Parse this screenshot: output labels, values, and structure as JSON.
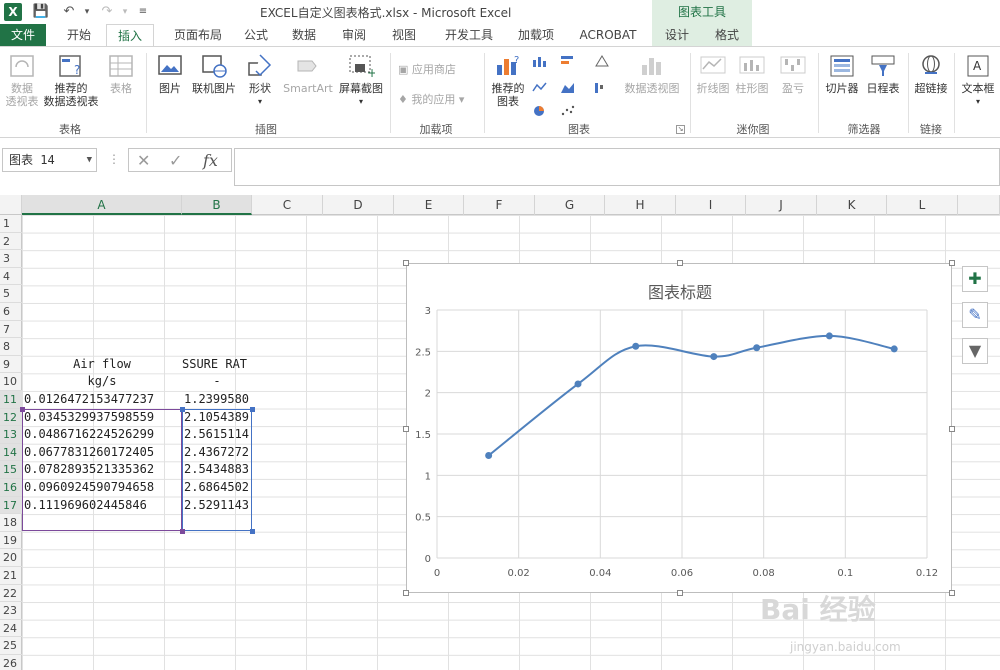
{
  "window": {
    "title": "EXCEL自定义图表格式.xlsx - Microsoft Excel",
    "app_icon": "X",
    "tools_tab_head": "图表工具"
  },
  "tabs": [
    "文件",
    "开始",
    "插入",
    "页面布局",
    "公式",
    "数据",
    "审阅",
    "视图",
    "开发工具",
    "加载项",
    "ACROBAT",
    "设计",
    "格式"
  ],
  "ribbon": {
    "groups": {
      "tables": "表格",
      "illustrations": "插图",
      "addins": "加载项",
      "charts": "图表",
      "sparklines": "迷你图",
      "filters": "筛选器",
      "links": "链接"
    },
    "buttons": {
      "pivot1": "数据",
      "pivot2": "透视表",
      "rec_pivot1": "推荐的",
      "rec_pivot2": "数据透视表",
      "table": "表格",
      "picture": "图片",
      "online_picture": "联机图片",
      "shapes": "形状",
      "smartart": "SmartArt",
      "screenshot": "屏幕截图",
      "app_store": "应用商店",
      "my_apps": "我的应用",
      "rec_chart1": "推荐的",
      "rec_chart2": "图表",
      "pivot_chart": "数据透视图",
      "line": "折线图",
      "column": "柱形图",
      "winloss": "盈亏",
      "slicer": "切片器",
      "timeline": "日程表",
      "hyperlink": "超链接",
      "textbox": "文本框"
    }
  },
  "formula_bar": {
    "name_box": "图表 14",
    "formula": ""
  },
  "columns": [
    "A",
    "B",
    "C",
    "D",
    "E",
    "F",
    "G",
    "H",
    "I",
    "J",
    "K",
    "L"
  ],
  "rows": [
    "1",
    "2",
    "3",
    "4",
    "5",
    "6",
    "7",
    "8",
    "9",
    "10",
    "11",
    "12",
    "13",
    "14",
    "15",
    "16",
    "17",
    "18",
    "19",
    "20",
    "21",
    "22",
    "23",
    "24",
    "25",
    "26"
  ],
  "sheet": {
    "header_a1": "Air flow",
    "header_a2": "kg/s",
    "header_b1": "SSURE RAT",
    "header_b2": "-",
    "col_a": [
      "0.0126472153477237",
      "0.0345329937598559",
      "0.0486716224526299",
      "0.0677831260172405",
      "0.0782893521335362",
      "0.0960924590794658",
      "0.111969602445846"
    ],
    "col_b": [
      "1.2399580",
      "2.1054389",
      "2.5615114",
      "2.4367272",
      "2.5434883",
      "2.6864502",
      "2.5291143"
    ]
  },
  "chart_data": {
    "type": "scatter",
    "title": "图表标题",
    "xlabel": "",
    "ylabel": "",
    "smooth": true,
    "markers": true,
    "x": [
      0.0126472153477237,
      0.0345329937598559,
      0.0486716224526299,
      0.0677831260172405,
      0.0782893521335362,
      0.0960924590794658,
      0.111969602445846
    ],
    "y": [
      1.239958,
      2.1054389,
      2.5615114,
      2.4367272,
      2.5434883,
      2.6864502,
      2.5291143
    ],
    "xlim": [
      0,
      0.12
    ],
    "ylim": [
      0,
      3
    ],
    "xticks": [
      "0",
      "0.02",
      "0.04",
      "0.06",
      "0.08",
      "0.1",
      "0.12"
    ],
    "yticks": [
      "0",
      "0.5",
      "1",
      "1.5",
      "2",
      "2.5",
      "3"
    ],
    "grid": true,
    "series_color": "#4f81bd"
  },
  "watermark": {
    "main": "Bai 经验",
    "sub": "jingyan.baidu.com"
  },
  "colors": {
    "excel_green": "#217346",
    "selection_purple": "#7c4a9b",
    "selection_blue": "#4472c4"
  }
}
